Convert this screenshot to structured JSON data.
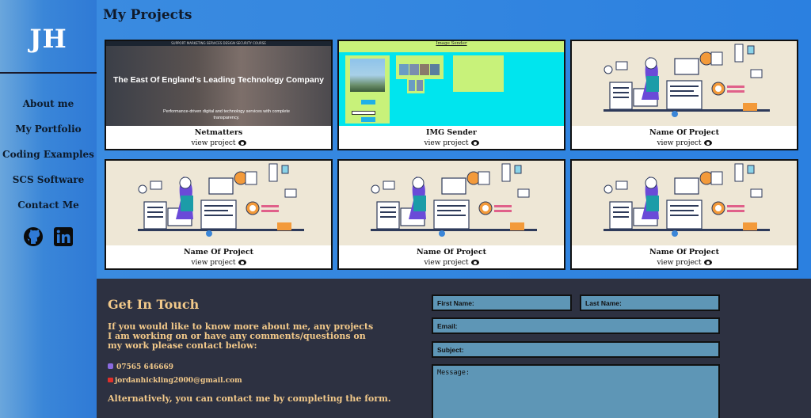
{
  "sidebar": {
    "logo": "JH",
    "nav": [
      "About me",
      "My Portfolio",
      "Coding Examples",
      "SCS Software",
      "Contact Me"
    ],
    "social": [
      {
        "icon": "github-icon"
      },
      {
        "icon": "linkedin-icon"
      }
    ]
  },
  "projects": {
    "title": "My Projects",
    "view_label": "view project",
    "netmatters_thumb": {
      "topbar": "SUPPORT   MARKETING   SERVICES   DESIGN   SECURITY   COURSE",
      "heading": "The East Of England's Leading Technology Company",
      "sub": "Performance-driven digital and technology services with complete transparency."
    },
    "img_sender_thumb": {
      "bar": "Image Sender"
    },
    "cards": [
      {
        "name": "Netmatters"
      },
      {
        "name": "IMG Sender"
      },
      {
        "name": "Name Of Project"
      },
      {
        "name": "Name Of Project"
      },
      {
        "name": "Name Of Project"
      },
      {
        "name": "Name Of Project"
      }
    ]
  },
  "contact": {
    "title": "Get In Touch",
    "text": "If you would like to know more about me, any projects I am working on or have any comments/questions on my work please contact below:",
    "phone": "07565 646669",
    "email": "jordanhickling2000@gmail.com",
    "alt": "Alternatively, you can contact me by completing the form.",
    "form": {
      "first_name": "First Name:",
      "last_name": "Last Name:",
      "email": "Email:",
      "subject": "Subject:",
      "message": "Message:"
    }
  },
  "colors": {
    "accent": "#2b80e0",
    "contact_bg": "#2d3141",
    "contact_text": "#f2c98a",
    "field_bg": "#5e96b6"
  }
}
